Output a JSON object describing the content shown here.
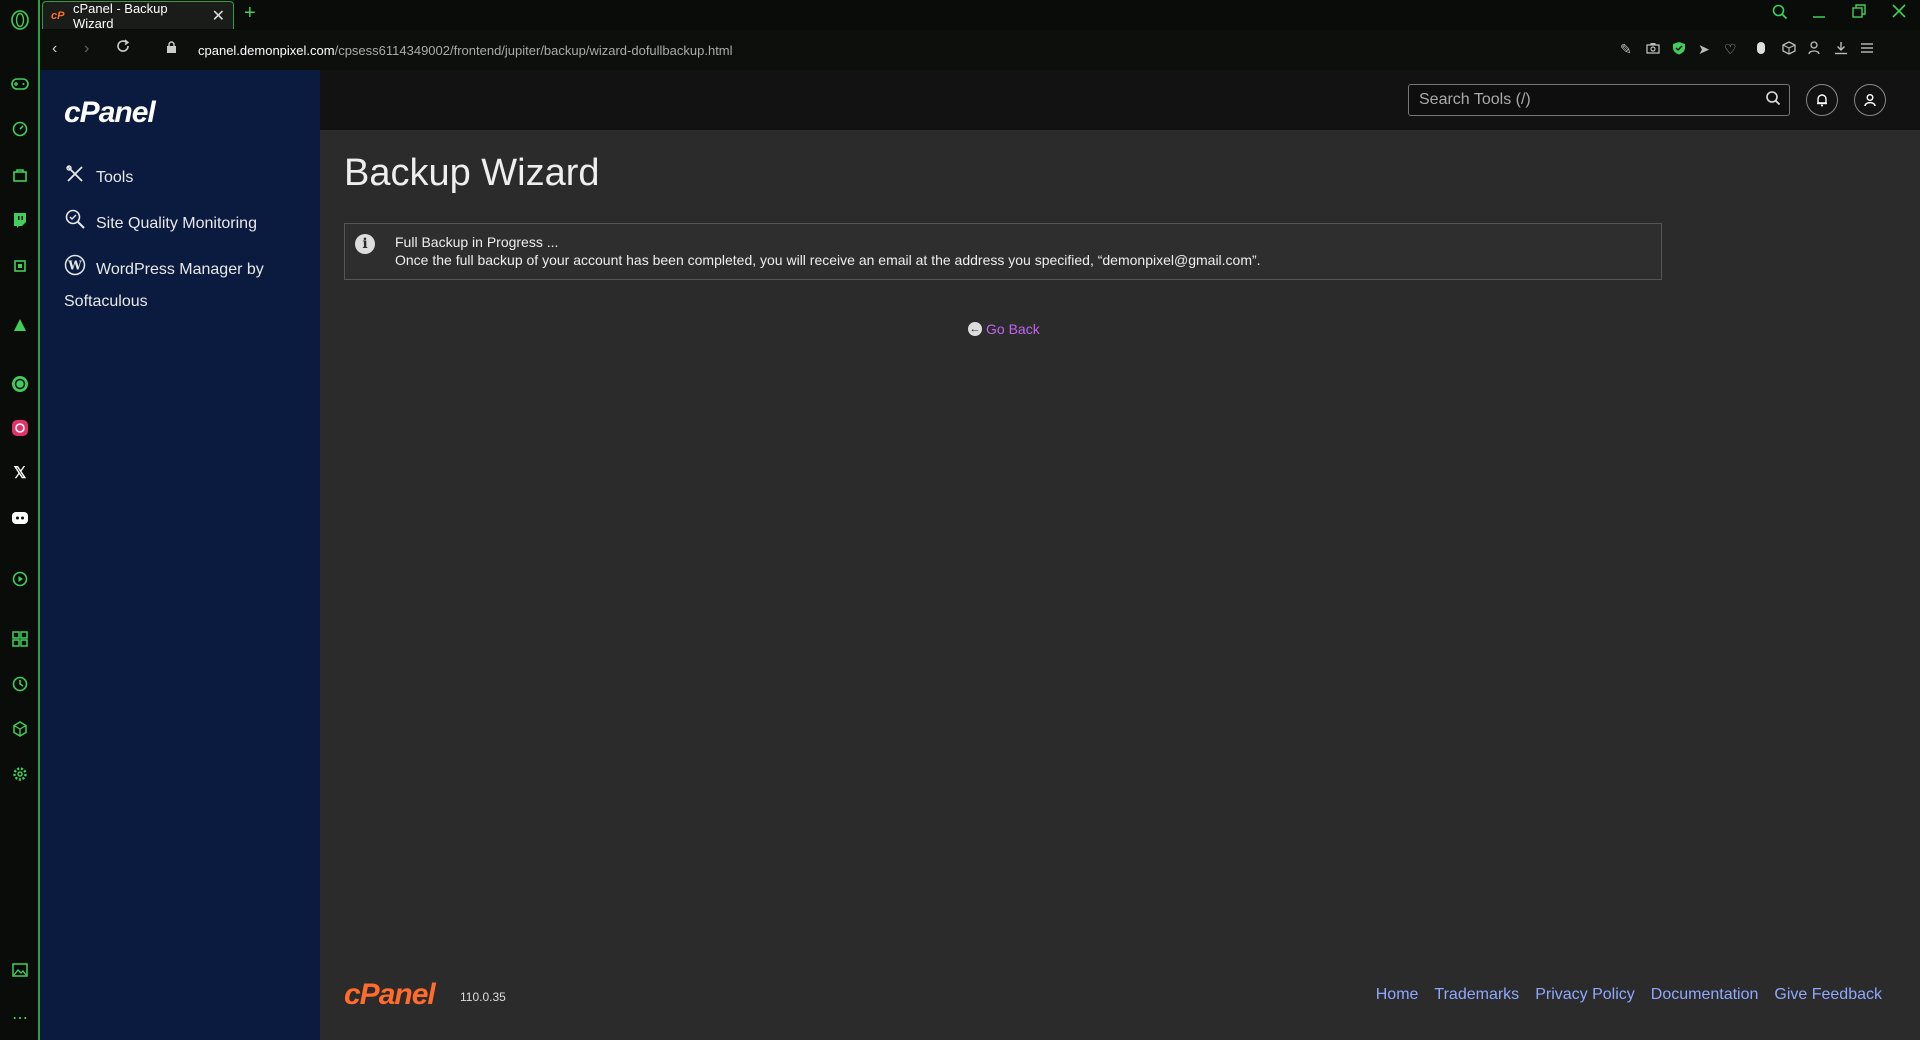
{
  "browser": {
    "tab_title": "cPanel - Backup Wizard",
    "tab_favicon": "cP",
    "url_host": "cpanel.demonpixel.com",
    "url_path": "/cpsess6114349002/frontend/jupiter/backup/wizard-dofullbackup.html"
  },
  "sidebar": {
    "logo": "cPanel",
    "items": [
      {
        "label": "Tools",
        "icon": "tools-icon"
      },
      {
        "label": "Site Quality Monitoring",
        "icon": "site-quality-icon"
      },
      {
        "label": "WordPress Manager by",
        "label2": "Softaculous",
        "icon": "wordpress-icon"
      }
    ]
  },
  "header": {
    "search_placeholder": "Search Tools (/)"
  },
  "main": {
    "title": "Backup Wizard",
    "alert_line1": "Full Backup in Progress ...",
    "alert_line2": "Once the full backup of your account has been completed, you will receive an email at the address you specified, “demonpixel@gmail.com”.",
    "go_back": "Go Back"
  },
  "footer": {
    "logo": "cPanel",
    "version": "110.0.35",
    "links": [
      "Home",
      "Trademarks",
      "Privacy Policy",
      "Documentation",
      "Give Feedback"
    ]
  },
  "colors": {
    "opera_accent": "#3fcf5a",
    "cpanel_sidebar": "#0b1a3f",
    "cpanel_orange": "#ff6c2c",
    "link_purple": "#c264f0",
    "footer_link": "#8fa8ff"
  }
}
